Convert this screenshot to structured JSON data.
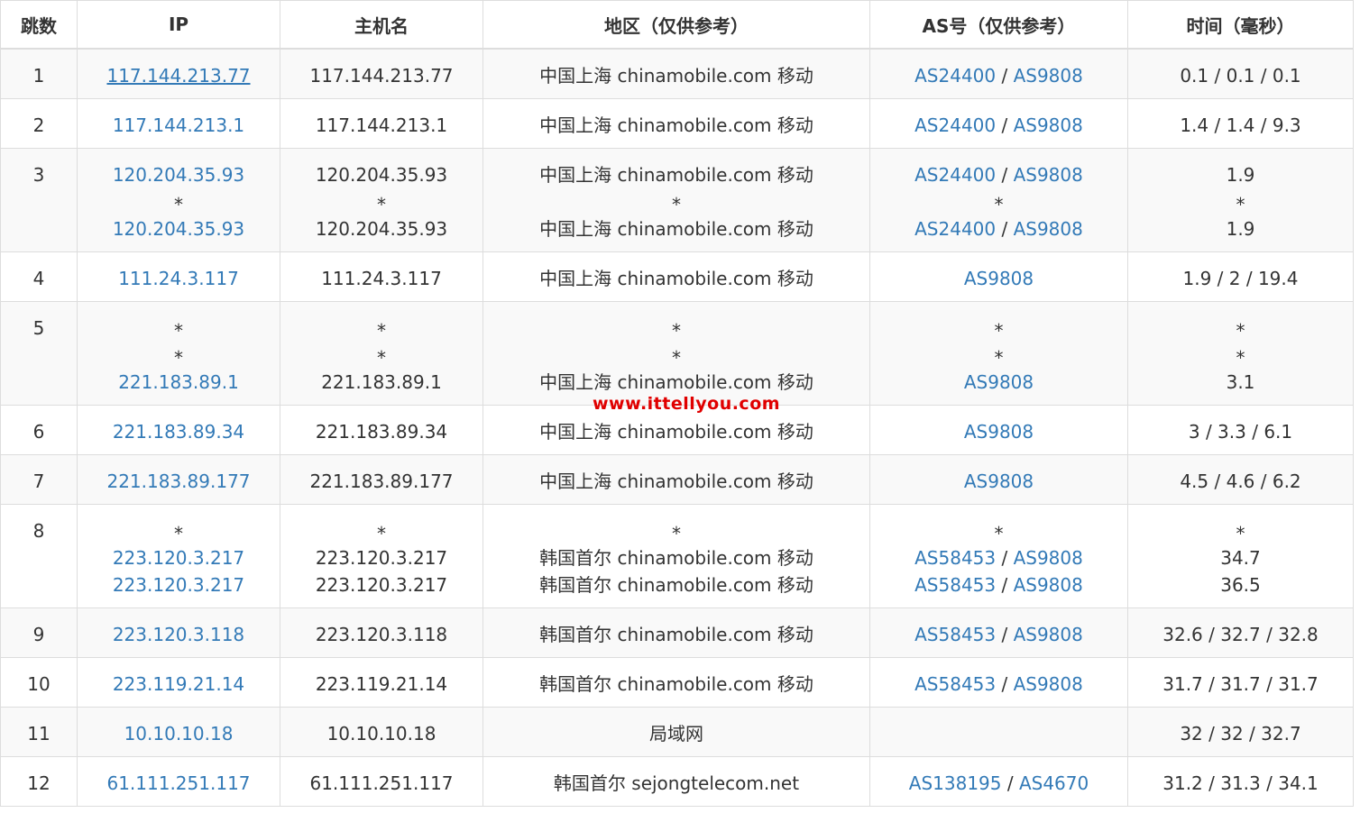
{
  "headers": [
    "跳数",
    "IP",
    "主机名",
    "地区（仅供参考）",
    "AS号（仅供参考）",
    "时间（毫秒）"
  ],
  "watermark": "www.ittellyou.com",
  "rows": [
    {
      "hop": "1",
      "lines": [
        {
          "ip": "117.144.213.77",
          "host": "117.144.213.77",
          "region": "中国上海 chinamobile.com 移动",
          "as": [
            "AS24400",
            "AS9808"
          ],
          "time": "0.1 / 0.1 / 0.1"
        }
      ]
    },
    {
      "hop": "2",
      "lines": [
        {
          "ip": "117.144.213.1",
          "host": "117.144.213.1",
          "region": "中国上海 chinamobile.com 移动",
          "as": [
            "AS24400",
            "AS9808"
          ],
          "time": "1.4 / 1.4 / 9.3"
        }
      ]
    },
    {
      "hop": "3",
      "lines": [
        {
          "ip": "120.204.35.93",
          "host": "120.204.35.93",
          "region": "中国上海 chinamobile.com 移动",
          "as": [
            "AS24400",
            "AS9808"
          ],
          "time": "1.9"
        },
        {
          "ip": "*",
          "host": "*",
          "region": "*",
          "as": [
            "*"
          ],
          "time": "*"
        },
        {
          "ip": "120.204.35.93",
          "host": "120.204.35.93",
          "region": "中国上海 chinamobile.com 移动",
          "as": [
            "AS24400",
            "AS9808"
          ],
          "time": "1.9"
        }
      ]
    },
    {
      "hop": "4",
      "lines": [
        {
          "ip": "111.24.3.117",
          "host": "111.24.3.117",
          "region": "中国上海 chinamobile.com 移动",
          "as": [
            "AS9808"
          ],
          "time": "1.9 / 2 / 19.4"
        }
      ]
    },
    {
      "hop": "5",
      "lines": [
        {
          "ip": "*",
          "host": "*",
          "region": "*",
          "as": [
            "*"
          ],
          "time": "*"
        },
        {
          "ip": "*",
          "host": "*",
          "region": "*",
          "as": [
            "*"
          ],
          "time": "*"
        },
        {
          "ip": "221.183.89.1",
          "host": "221.183.89.1",
          "region": "中国上海 chinamobile.com 移动",
          "as": [
            "AS9808"
          ],
          "time": "3.1"
        }
      ]
    },
    {
      "hop": "6",
      "lines": [
        {
          "ip": "221.183.89.34",
          "host": "221.183.89.34",
          "region": "中国上海 chinamobile.com 移动",
          "as": [
            "AS9808"
          ],
          "time": "3 / 3.3 / 6.1"
        }
      ]
    },
    {
      "hop": "7",
      "lines": [
        {
          "ip": "221.183.89.177",
          "host": "221.183.89.177",
          "region": "中国上海 chinamobile.com 移动",
          "as": [
            "AS9808"
          ],
          "time": "4.5 / 4.6 / 6.2"
        }
      ]
    },
    {
      "hop": "8",
      "lines": [
        {
          "ip": "*",
          "host": "*",
          "region": "*",
          "as": [
            "*"
          ],
          "time": "*"
        },
        {
          "ip": "223.120.3.217",
          "host": "223.120.3.217",
          "region": "韩国首尔 chinamobile.com 移动",
          "as": [
            "AS58453",
            "AS9808"
          ],
          "time": "34.7"
        },
        {
          "ip": "223.120.3.217",
          "host": "223.120.3.217",
          "region": "韩国首尔 chinamobile.com 移动",
          "as": [
            "AS58453",
            "AS9808"
          ],
          "time": "36.5"
        }
      ]
    },
    {
      "hop": "9",
      "lines": [
        {
          "ip": "223.120.3.118",
          "host": "223.120.3.118",
          "region": "韩国首尔 chinamobile.com 移动",
          "as": [
            "AS58453",
            "AS9808"
          ],
          "time": "32.6 / 32.7 / 32.8"
        }
      ]
    },
    {
      "hop": "10",
      "lines": [
        {
          "ip": "223.119.21.14",
          "host": "223.119.21.14",
          "region": "韩国首尔 chinamobile.com 移动",
          "as": [
            "AS58453",
            "AS9808"
          ],
          "time": "31.7 / 31.7 / 31.7"
        }
      ]
    },
    {
      "hop": "11",
      "lines": [
        {
          "ip": "10.10.10.18",
          "host": "10.10.10.18",
          "region": "局域网",
          "as": [],
          "time": "32 / 32 / 32.7"
        }
      ]
    },
    {
      "hop": "12",
      "lines": [
        {
          "ip": "61.111.251.117",
          "host": "61.111.251.117",
          "region": "韩国首尔 sejongtelecom.net",
          "as": [
            "AS138195",
            "AS4670"
          ],
          "time": "31.2 / 31.3 / 34.1"
        }
      ]
    }
  ]
}
